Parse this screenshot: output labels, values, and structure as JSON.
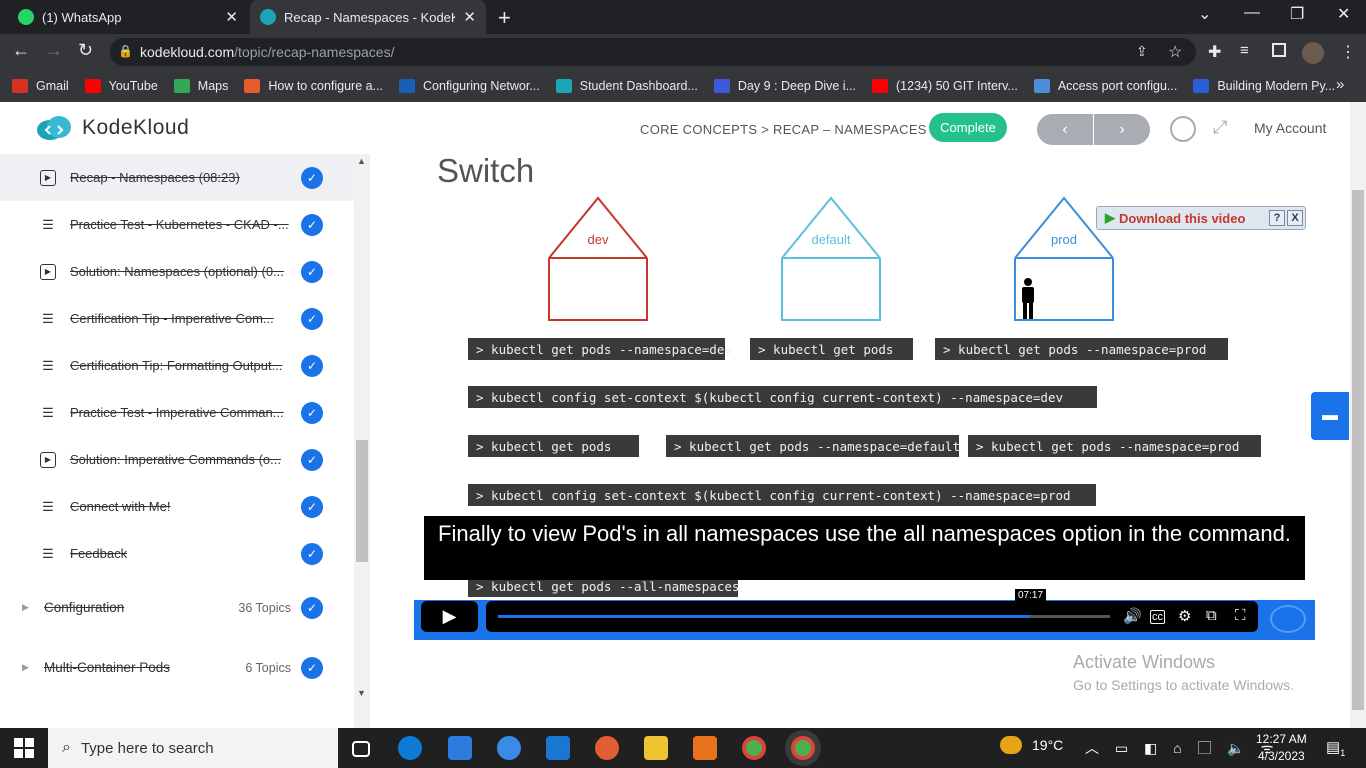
{
  "browser": {
    "tabs": [
      {
        "title": "(1) WhatsApp"
      },
      {
        "title": "Recap - Namespaces - KodeKloud"
      }
    ],
    "new_tab": "+",
    "url_domain": "kodekloud.com",
    "url_path": "/topic/recap-namespaces/",
    "bookmarks": [
      {
        "label": "Gmail",
        "color": "#d93025"
      },
      {
        "label": "YouTube",
        "color": "#ff0000"
      },
      {
        "label": "Maps",
        "color": "#34a853"
      },
      {
        "label": "How to configure a...",
        "color": "#e65c2a"
      },
      {
        "label": "Configuring Networ...",
        "color": "#1a5fb4"
      },
      {
        "label": "Student Dashboard...",
        "color": "#1ba3b8"
      },
      {
        "label": "Day 9 : Deep Dive i...",
        "color": "#3b5bdb"
      },
      {
        "label": "(1234) 50 GIT Interv...",
        "color": "#ff0000"
      },
      {
        "label": "Access port configu...",
        "color": "#4a90d9"
      },
      {
        "label": "Building Modern Py...",
        "color": "#2b5fd9"
      }
    ],
    "more_bookmarks": "»"
  },
  "header": {
    "logo_text": "KodeKloud",
    "breadcrumb": "CORE CONCEPTS > RECAP – NAMESPACES",
    "complete_label": "Complete",
    "prev_label": "‹",
    "next_label": "›",
    "account_label": "My Account"
  },
  "sidebar": {
    "items": [
      {
        "label": "Recap - Namespaces (08:23)",
        "icon": "play",
        "active": true
      },
      {
        "label": "Practice Test - Kubernetes - CKAD -...",
        "icon": "list"
      },
      {
        "label": "Solution: Namespaces (optional) (0...",
        "icon": "play"
      },
      {
        "label": "Certification Tip - Imperative Com...",
        "icon": "list"
      },
      {
        "label": "Certification Tip: Formatting Output...",
        "icon": "list"
      },
      {
        "label": "Practice Test - Imperative Comman...",
        "icon": "list"
      },
      {
        "label": "Solution: Imperative Commands (o...",
        "icon": "play"
      },
      {
        "label": "Connect with Me!",
        "icon": "list"
      },
      {
        "label": "Feedback",
        "icon": "list"
      }
    ],
    "sections": [
      {
        "label": "Configuration",
        "count": "36 Topics"
      },
      {
        "label": "Multi-Container Pods",
        "count": "6 Topics"
      }
    ]
  },
  "slide": {
    "title": "Switch",
    "houses": [
      {
        "label": "dev",
        "color": "#c0392b"
      },
      {
        "label": "default",
        "color": "#5bc0de"
      },
      {
        "label": "prod",
        "color": "#3b8fd9"
      }
    ],
    "commands": [
      "> kubectl get pods --namespace=dev",
      "> kubectl get pods",
      "> kubectl get pods --namespace=prod",
      "> kubectl config set-context $(kubectl config current-context) --namespace=dev",
      "> kubectl get pods",
      "> kubectl get pods --namespace=default",
      "> kubectl get pods --namespace=prod",
      "> kubectl config set-context $(kubectl config current-context) --namespace=prod",
      "> kubectl get pods --all-namespaces"
    ],
    "caption": "Finally to view Pod's in all namespaces use the all namespaces option in the command."
  },
  "download": {
    "label": "Download this video",
    "help": "?",
    "close": "X"
  },
  "player": {
    "time_tooltip": "07:17",
    "progress": 0.87
  },
  "watermark": {
    "line1": "Activate Windows",
    "line2": "Go to Settings to activate Windows."
  },
  "taskbar": {
    "search_placeholder": "Type here to search",
    "weather": "19°C",
    "time": "12:27 AM",
    "date": "4/3/2023",
    "notifications": "1"
  }
}
